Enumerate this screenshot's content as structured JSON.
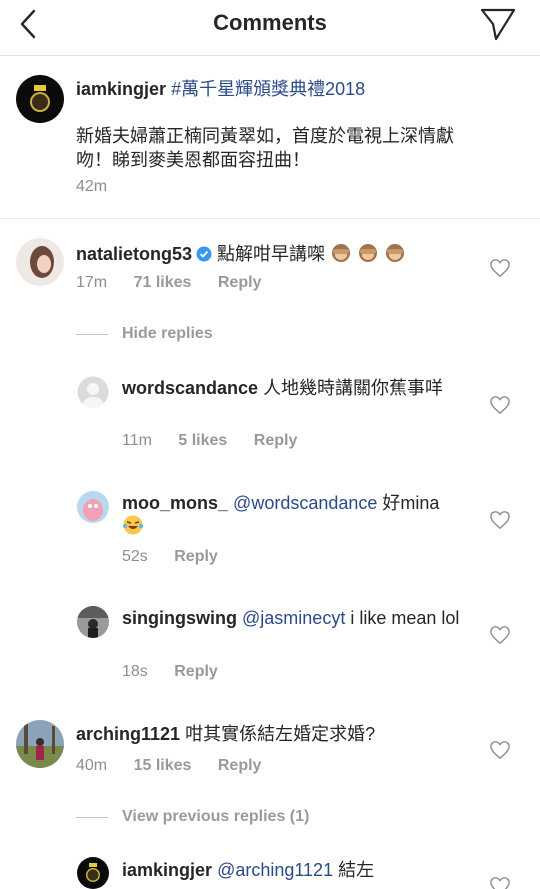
{
  "header": {
    "title": "Comments"
  },
  "caption": {
    "username": "iamkingjer",
    "hashtag": "#萬千星輝頒獎典禮2018",
    "text": "新婚夫婦蕭正楠同黃翠如，首度於電視上深情獻吻！睇到麥美恩都面容扭曲！",
    "time": "42m"
  },
  "comments": [
    {
      "username": "natalietong53",
      "text": "點解咁早講㗎",
      "time": "17m",
      "likes": "71 likes",
      "reply": "Reply"
    },
    {
      "username": "wordscandance",
      "text": "人地幾時講關你蕉事咩",
      "time": "11m",
      "likes": "5 likes",
      "reply": "Reply"
    },
    {
      "username": "moo_mons_",
      "mention": "@wordscandance",
      "text": "好mina",
      "time": "52s",
      "reply": "Reply"
    },
    {
      "username": "singingswing",
      "mention": "@jasminecyt",
      "text": "i like mean lol",
      "time": "18s",
      "reply": "Reply"
    },
    {
      "username": "arching1121",
      "text": "咁其實係結左婚定求婚?",
      "time": "40m",
      "likes": "15 likes",
      "reply": "Reply"
    },
    {
      "username": "iamkingjer",
      "mention": "@arching1121",
      "text": "結左"
    }
  ],
  "toggles": {
    "hide_replies": "Hide replies",
    "view_previous": "View previous replies (1)"
  },
  "colors": {
    "link": "#2b4a8a",
    "muted": "#8e8e8e",
    "verified": "#3897f0"
  }
}
